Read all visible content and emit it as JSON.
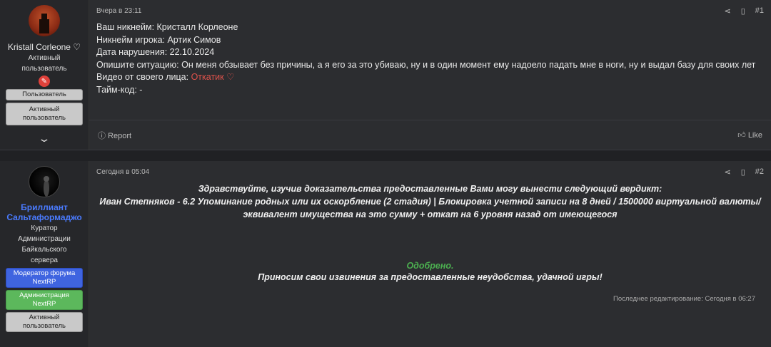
{
  "post1": {
    "author": {
      "name": "Kristall Corleone ♡",
      "title": "Активный пользователь"
    },
    "banners": [
      "Пользователь",
      "Активный пользователь"
    ],
    "date": "Вчера в 23:11",
    "number": "#1",
    "lines": [
      "Ваш никнейм: Кристалл Корлеоне",
      "Никнейм игрока: Артик Симов",
      "Дата нарушения: 22.10.2024",
      "Опишите ситуацию: Он меня обзывает без причины, а я его за это убиваю, ну и в один момент ему надоело падать мне в ноги, ну и выдал базу для своих лет"
    ],
    "video_label": "Видео от своего лица:",
    "video_link": "Откатик ♡",
    "timecode": "Тайм-код: -",
    "report_label": "Report",
    "like_label": "Like"
  },
  "post2": {
    "author": {
      "name": "Бриллиант Сальтаформаджо",
      "title": "Куратор Администрации Байкальского сервера"
    },
    "banners": [
      "Модератор форума NextRP",
      "Администрация NextRP",
      "Активный пользователь"
    ],
    "date": "Сегодня в 05:04",
    "number": "#2",
    "verdict_lines": [
      "Здравствуйте, изучив доказательства предоставленные Вами могу вынести следующий вердикт:",
      "Иван Степняков - 6.2 Упоминание родных или их оскорбление (2 стадия) | Блокировка учетной записи на 8 дней / 1500000 виртуальной валюты/",
      "эквивалент имущества на это сумму + откат на 6 уровня назад от имеющегося"
    ],
    "approved": "Одобрено.",
    "apology": "Приносим свои извинения за предоставленные неудобства, удачной игры!",
    "edit_note": "Последнее редактирование: Сегодня в 06:27"
  },
  "colors": {
    "accent_blue": "#3f64e0",
    "accent_green": "#5cb85c",
    "link_red": "#e0524b",
    "approved_green": "#4caf50"
  }
}
